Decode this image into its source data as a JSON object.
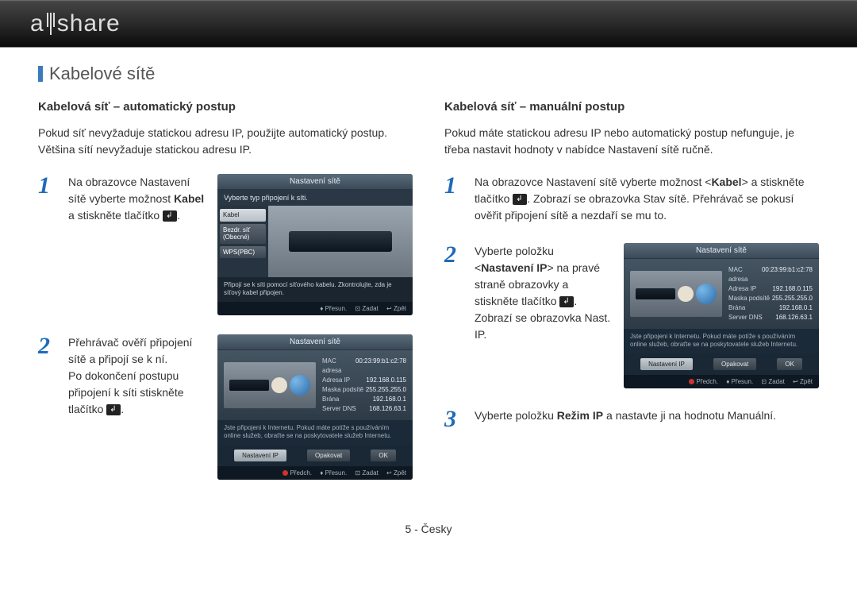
{
  "logo": "allshare",
  "section_title": "Kabelové sítě",
  "page_num": "5 - Česky",
  "left": {
    "subheading": "Kabelová síť – automatický postup",
    "intro": "Pokud síť nevyžaduje statickou adresu IP, použijte automatický postup. Většina sítí nevyžaduje statickou adresu IP.",
    "step1_a": "Na obrazovce Nastavení sítě vyberte možnost ",
    "step1_bold": "Kabel",
    "step1_b": " a stiskněte tlačítko ",
    "step1_c": ".",
    "step2_a": "Přehrávač ověří připojení sítě a připojí se k ní.",
    "step2_b": "Po dokončení postupu připojení k síti stiskněte tlačítko ",
    "step2_c": "."
  },
  "right": {
    "subheading": "Kabelová síť – manuální postup",
    "intro": "Pokud máte statickou adresu IP nebo automatický postup nefunguje, je třeba nastavit hodnoty v nabídce Nastavení sítě ručně.",
    "step1_a": "Na obrazovce Nastavení sítě vyberte možnost <",
    "step1_bold": "Kabel",
    "step1_b": "> a stiskněte tlačítko ",
    "step1_c": ". Zobrazí se obrazovka Stav sítě. Přehrávač se pokusí ověřit připojení sítě a nezdaří se mu to.",
    "step2_a": "Vyberte položku <",
    "step2_bold": "Nastavení IP",
    "step2_b": "> na pravé straně obrazovky a stiskněte tlačítko ",
    "step2_c": ". Zobrazí se obrazovka Nast. IP.",
    "step3_a": "Vyberte položku ",
    "step3_bold": "Režim IP",
    "step3_b": " a nastavte ji na hodnotu Manuální."
  },
  "tv1": {
    "title": "Nastavení sítě",
    "sub": "Vyberte typ připojení k síti.",
    "opt1": "Kabel",
    "opt2": "Bezdr. síť (Obecné)",
    "opt3": "WPS(PBC)",
    "hint": "Připojí se k síti pomocí síťového kabelu. Zkontrolujte, zda je síťový kabel připojen.",
    "f1": "Přesun.",
    "f2": "Zadat",
    "f3": "Zpět"
  },
  "tv2": {
    "title": "Nastavení sítě",
    "mac_l": "MAC adresa",
    "mac_v": "00:23:99:b1:c2:78",
    "ip_l": "Adresa IP",
    "ip_v": "192.168.0.115",
    "mask_l": "Maska podsítě",
    "mask_v": "255.255.255.0",
    "gw_l": "Brána",
    "gw_v": "192.168.0.1",
    "dns_l": "Server DNS",
    "dns_v": "168.126.63.1",
    "msg": "Jste připojeni k Internetu. Pokud máte potíže s používáním online služeb, obraťte se na poskytovatele služeb Internetu.",
    "btn1": "Nastavení IP",
    "btn2": "Opakovat",
    "btn3": "OK",
    "f1": "Předch.",
    "f2": "Přesun.",
    "f3": "Zadat",
    "f4": "Zpět"
  }
}
